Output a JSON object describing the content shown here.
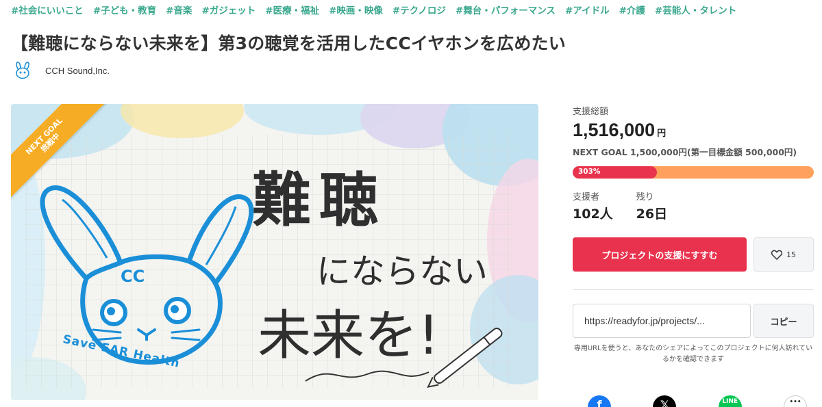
{
  "tags": [
    "#社会にいいこと",
    "#子ども・教育",
    "#音楽",
    "#ガジェット",
    "#医療・福祉",
    "#映画・映像",
    "#テクノロジ",
    "#舞台・パフォーマンス",
    "#アイドル",
    "#介護",
    "#芸能人・タレント"
  ],
  "title": "【難聴にならない未来を】第3の聴覚を活用したCCイヤホンを広めたい",
  "owner": {
    "name": "CCH Sound,Inc."
  },
  "hero": {
    "ribbon_line1": "NEXT GOAL",
    "ribbon_line2": "挑戦中",
    "headline_1": "難聴",
    "headline_2": "にならない",
    "headline_3": "未来を!",
    "logo_initials": "CC",
    "logo_arc": "Save EAR Health"
  },
  "funding": {
    "total_label": "支援総額",
    "total_amount": "1,516,000",
    "currency": "円",
    "next_goal": "NEXT GOAL 1,500,000円(第一目標金額 500,000円)",
    "progress_text": "303%",
    "progress_fraction": 0.35,
    "supporters_label": "支援者",
    "supporters_value": "102人",
    "remaining_label": "残り",
    "remaining_value": "26日"
  },
  "actions": {
    "support_label": "プロジェクトの支援にすすむ",
    "favorite_count": "15"
  },
  "share": {
    "url": "https://readyfor.jp/projects/...",
    "copy_label": "コピー",
    "note": "専用URLを使うと、あなたのシェアによってこのプロジェクトに何人訪れているかを確認できます"
  },
  "colors": {
    "accent": "#e9334e",
    "tag": "#3aa88e",
    "progress_track": "#ffa15c",
    "ribbon": "#f6ad25",
    "logo_blue": "#1a8fd8"
  },
  "socials": [
    "facebook-icon",
    "x-icon",
    "line-icon",
    "more-icon"
  ]
}
